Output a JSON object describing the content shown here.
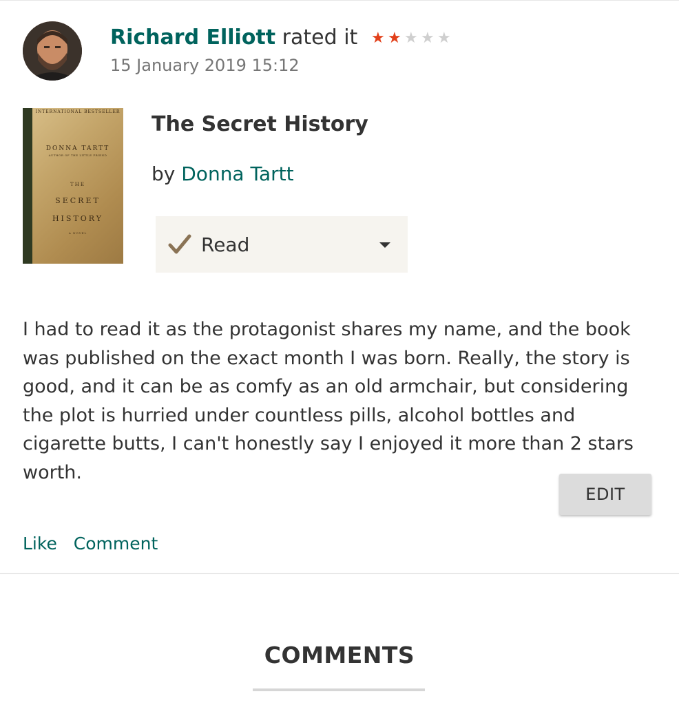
{
  "review": {
    "reviewer_name": "Richard Elliott",
    "rated_text": "rated it",
    "rating": 2,
    "rating_max": 5,
    "date": "15 January 2019 15:12",
    "text": "I had to read it as the protagonist shares my name, and the book was published on the exact month I was born. Really, the story is good, and it can be as comfy as an old armchair, but considering the plot is hurried under countless pills, alcohol bottles and cigarette butts, I can't honestly say I enjoyed it more than 2 stars worth."
  },
  "book": {
    "title": "The Secret History",
    "by_prefix": "by",
    "author": "Donna Tartt",
    "cover": {
      "banner": "INTERNATIONAL BESTSELLER",
      "author": "DONNA TARTT",
      "byline": "AUTHOR OF THE LITTLE FRIEND",
      "title_line1": "THE",
      "title_line2": "SECRET",
      "title_line3": "HISTORY",
      "subtitle": "A NOVEL"
    }
  },
  "shelf": {
    "label": "Read",
    "icon": "check-icon",
    "dropdown_icon": "caret-down-icon"
  },
  "actions": {
    "edit_label": "EDIT",
    "like_label": "Like",
    "comment_label": "Comment"
  },
  "comments": {
    "heading": "COMMENTS"
  },
  "colors": {
    "link": "#00635d",
    "star_on": "#e2401a",
    "star_off": "#cfcfcf",
    "shelf_bg": "#f6f4ef",
    "check": "#8a7355"
  }
}
